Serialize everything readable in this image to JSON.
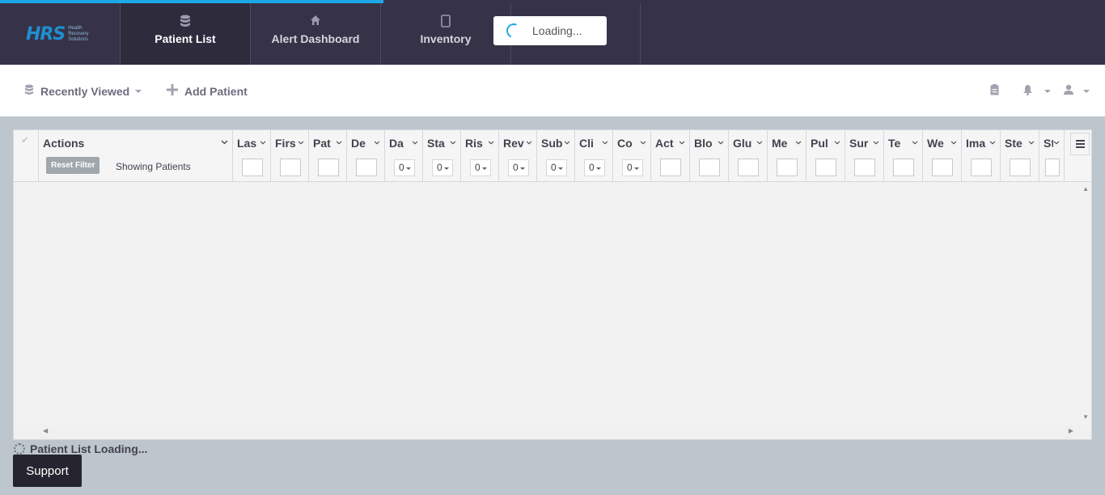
{
  "brand": {
    "logo_mark": "HRS",
    "logo_text": "Health Recovery Solutions",
    "accent": "#1ea7e6",
    "nav_bg": "#363348"
  },
  "nav": {
    "tabs": [
      {
        "label": "Patient List",
        "icon": "database-icon",
        "active": true
      },
      {
        "label": "Alert Dashboard",
        "icon": "home-icon",
        "active": false
      },
      {
        "label": "Inventory",
        "icon": "tablet-icon",
        "active": false
      }
    ],
    "loading_popup": "Loading..."
  },
  "toolbar": {
    "recently_viewed": "Recently Viewed",
    "add_patient": "Add Patient"
  },
  "grid": {
    "actions_header": "Actions",
    "reset_filter": "Reset Filter",
    "showing": "Showing Patients",
    "columns": [
      {
        "label": "Las",
        "filter": "input"
      },
      {
        "label": "Firs",
        "filter": "input"
      },
      {
        "label": "Pat",
        "filter": "input"
      },
      {
        "label": "De",
        "filter": "input"
      },
      {
        "label": "Da",
        "filter": "select",
        "value": "0"
      },
      {
        "label": "Sta",
        "filter": "select",
        "value": "0"
      },
      {
        "label": "Ris",
        "filter": "select",
        "value": "0"
      },
      {
        "label": "Rev",
        "filter": "select",
        "value": "0"
      },
      {
        "label": "Sub",
        "filter": "select",
        "value": "0"
      },
      {
        "label": "Cli",
        "filter": "select",
        "value": "0"
      },
      {
        "label": "Co",
        "filter": "select",
        "value": "0"
      },
      {
        "label": "Act",
        "filter": "input"
      },
      {
        "label": "Blo",
        "filter": "input"
      },
      {
        "label": "Glu",
        "filter": "input"
      },
      {
        "label": "Me",
        "filter": "input"
      },
      {
        "label": "Pul",
        "filter": "input"
      },
      {
        "label": "Sur",
        "filter": "input"
      },
      {
        "label": "Te",
        "filter": "input"
      },
      {
        "label": "We",
        "filter": "input"
      },
      {
        "label": "Ima",
        "filter": "input"
      },
      {
        "label": "Ste",
        "filter": "input"
      },
      {
        "label": "Sty",
        "filter": "input"
      }
    ]
  },
  "status": {
    "list_loading": "Patient List Loading..."
  },
  "support_label": "Support"
}
